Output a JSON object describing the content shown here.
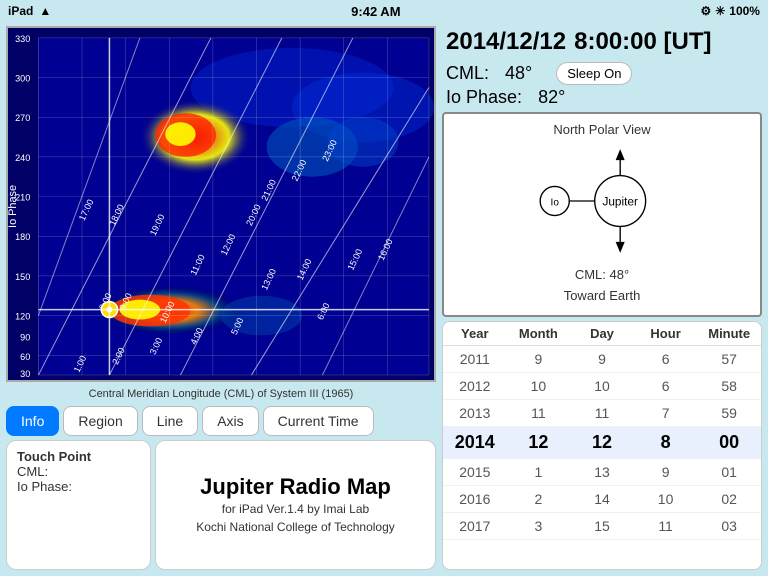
{
  "statusBar": {
    "carrier": "iPad",
    "wifi": "wifi",
    "time": "9:42 AM",
    "settings": "⚙",
    "bluetooth": "bluetooth",
    "battery": "100%"
  },
  "header": {
    "datetime": "2014/12/12",
    "time": "8:00:00 [UT]",
    "cml_label": "CML:",
    "cml_value": "48°",
    "io_phase_label": "Io Phase:",
    "io_phase_value": "82°",
    "sleep_btn": "Sleep On"
  },
  "polarView": {
    "title": "North Polar View",
    "cml_label": "CML:  48°",
    "toward_earth": "Toward Earth",
    "io_label": "Io",
    "jupiter_label": "Jupiter"
  },
  "buttons": [
    {
      "id": "info",
      "label": "Info",
      "active": true
    },
    {
      "id": "region",
      "label": "Region",
      "active": false
    },
    {
      "id": "line",
      "label": "Line",
      "active": false
    },
    {
      "id": "axis",
      "label": "Axis",
      "active": false
    },
    {
      "id": "current_time",
      "label": "Current Time",
      "active": false
    }
  ],
  "infoPanel": {
    "touch_point": "Touch Point",
    "cml_label": "CML:",
    "io_phase_label": "Io Phase:"
  },
  "titlePanel": {
    "main_title": "Jupiter Radio Map",
    "line1": "for iPad  Ver.1.4  by Imai Lab",
    "line2": "Kochi National College of Technology"
  },
  "mapLabel": {
    "x_axis": "Central Meridian Longitude (CML) of System III (1965)",
    "y_axis": "Io Phase"
  },
  "picker": {
    "headers": [
      "Year",
      "Month",
      "Day",
      "Hour",
      "Minute"
    ],
    "rows": [
      {
        "values": [
          "2011",
          "9",
          "9",
          "6",
          "57"
        ],
        "selected": false
      },
      {
        "values": [
          "2012",
          "10",
          "10",
          "6",
          "58"
        ],
        "selected": false
      },
      {
        "values": [
          "2013",
          "11",
          "11",
          "7",
          "59"
        ],
        "selected": false
      },
      {
        "values": [
          "2014",
          "12",
          "12",
          "8",
          "00"
        ],
        "selected": true
      },
      {
        "values": [
          "2015",
          "1",
          "13",
          "9",
          "01"
        ],
        "selected": false
      },
      {
        "values": [
          "2016",
          "2",
          "14",
          "10",
          "02"
        ],
        "selected": false
      },
      {
        "values": [
          "2017",
          "3",
          "15",
          "11",
          "03"
        ],
        "selected": false
      }
    ]
  }
}
